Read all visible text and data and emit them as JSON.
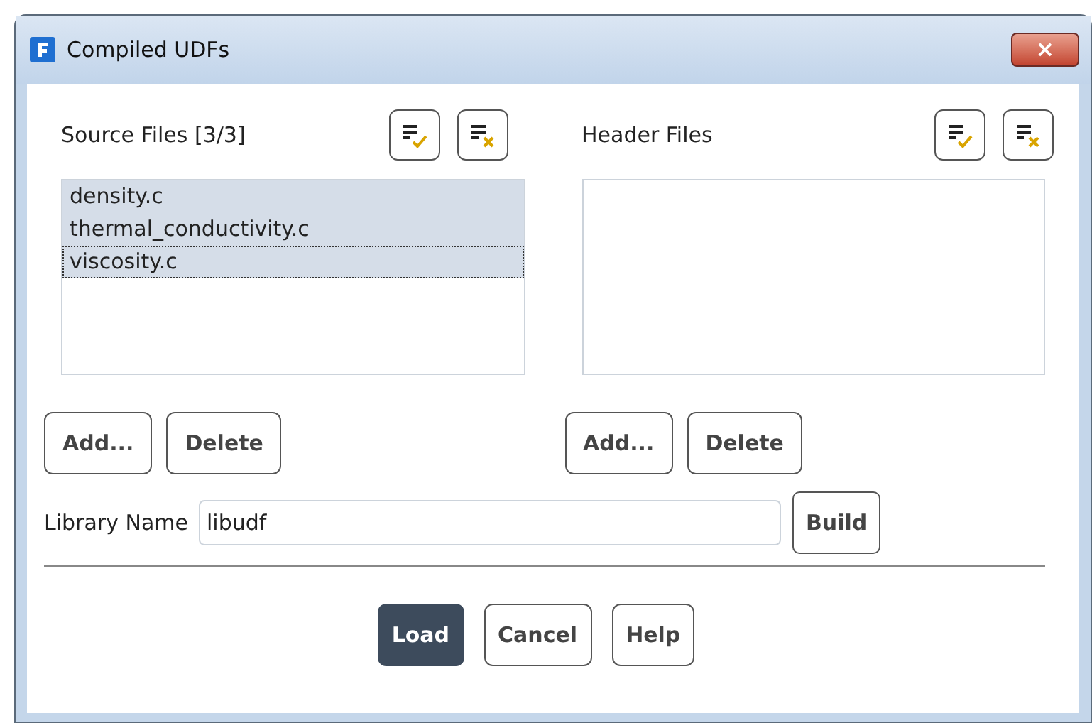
{
  "window": {
    "title": "Compiled UDFs",
    "close_button": "×"
  },
  "source_files": {
    "label": "Source Files [3/3]",
    "items": [
      {
        "name": "density.c",
        "selected": true,
        "focused": false
      },
      {
        "name": "thermal_conductivity.c",
        "selected": true,
        "focused": false
      },
      {
        "name": "viscosity.c",
        "selected": true,
        "focused": true
      }
    ],
    "buttons": [
      "Add...",
      "Delete"
    ]
  },
  "header_files": {
    "label": "Header Files",
    "buttons": [
      "Add...",
      "Delete"
    ]
  },
  "library_name": {
    "label": "Library Name",
    "value": "libudf",
    "button": "Build"
  },
  "buttons": [
    {
      "label": "Load",
      "primary": true
    },
    {
      "label": "Cancel",
      "primary": false
    },
    {
      "label": "Help",
      "primary": false
    }
  ]
}
